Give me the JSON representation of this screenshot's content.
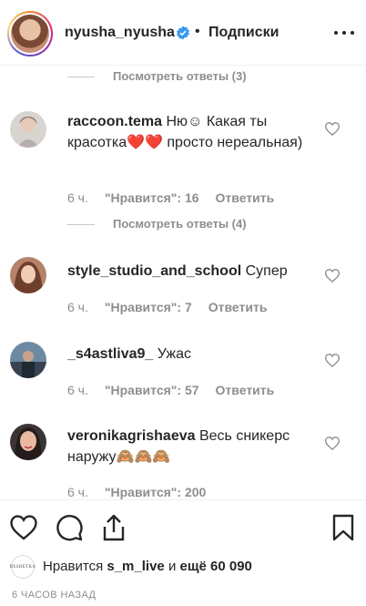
{
  "header": {
    "username": "nyusha_nyusha",
    "separator": "•",
    "follow_label": "Подписки"
  },
  "comments_panel": {
    "replies_top": "Посмотреть ответы (3)",
    "comments": [
      {
        "username": "raccoon.tema",
        "text": "Ню☺ Какая ты красотка❤️❤️ просто нереальная)",
        "time": "6 ч.",
        "likes": "\"Нравится\": 16",
        "reply": "Ответить",
        "view_replies": "Посмотреть ответы (4)"
      },
      {
        "username": "style_studio_and_school",
        "text": "Супер",
        "time": "6 ч.",
        "likes": "\"Нравится\": 7",
        "reply": "Ответить"
      },
      {
        "username": "_s4astliva9_",
        "text": "Ужас",
        "time": "6 ч.",
        "likes": "\"Нравится\": 57",
        "reply": "Ответить"
      },
      {
        "username": "veronikagrishaeva",
        "text": "Весь сникерс наружу🙈🙈🙈",
        "time": "6 ч.",
        "likes": "\"Нравится\": 200"
      }
    ]
  },
  "footer": {
    "liked_by_prefix": "Нравится",
    "liked_by_user": "s_m_live",
    "liked_by_conj": "и",
    "liked_by_count": "ещё 60 090",
    "liker_avatar_text": "RESHETKA",
    "time_ago": "6 ЧАСОВ НАЗАД"
  },
  "colors": {
    "text": "#262626",
    "secondary": "#8e8e8e",
    "verified": "#3897f0",
    "heart": "#d1002d"
  }
}
